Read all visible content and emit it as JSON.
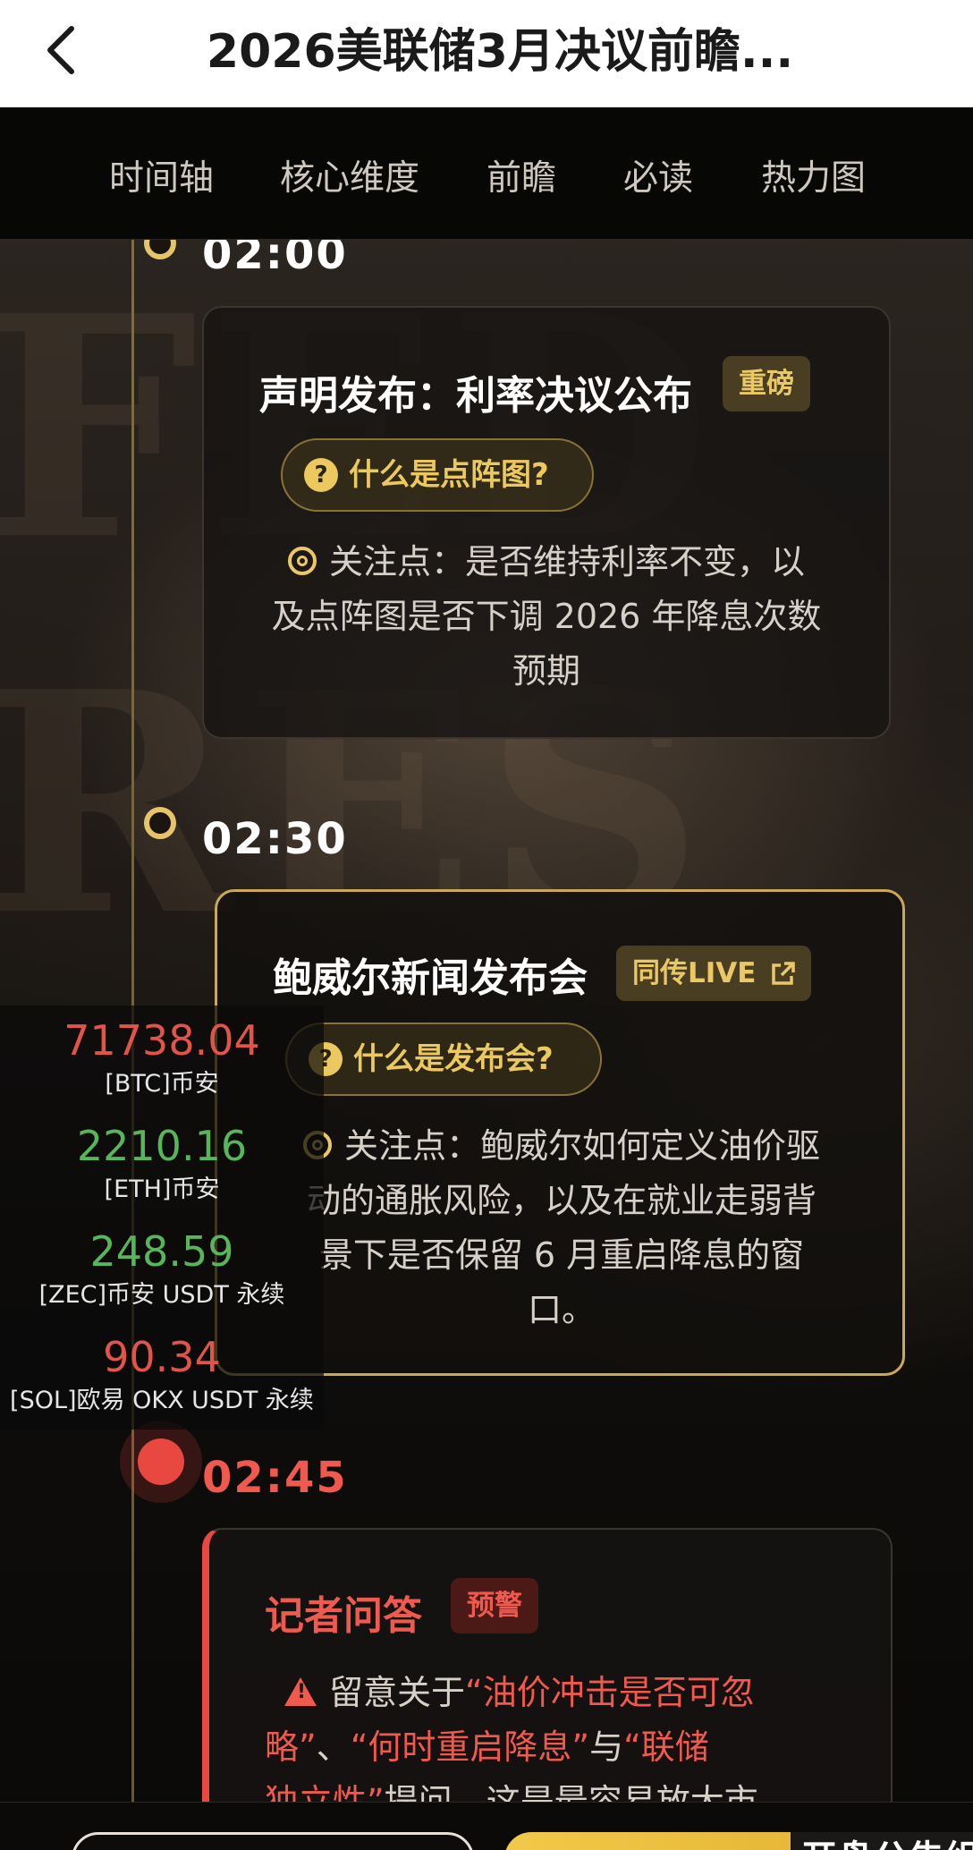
{
  "header": {
    "title": "2026美联储3月决议前瞻..."
  },
  "tabs": [
    "时间轴",
    "核心维度",
    "前瞻",
    "必读",
    "热力图"
  ],
  "events": [
    {
      "time": "02:00",
      "title": "声明发布：利率决议公布",
      "badge": "重磅",
      "pill": "什么是点阵图?",
      "focus_lines": [
        "关注点：是否维持利率不变，以",
        "及点阵图是否下调 2026 年降息次数",
        "预期"
      ]
    },
    {
      "time": "02:30",
      "title": "鲍威尔新闻发布会",
      "badge": "同传LIVE",
      "pill": "什么是发布会?",
      "focus_lines": [
        "关注点：鲍威尔如何定义油价驱",
        "动的通胀风险，以及在就业走弱背",
        "景下是否保留 6 月重启降息的窗",
        "口。"
      ]
    },
    {
      "time": "02:45",
      "title": "记者问答",
      "badge": "预警",
      "warn": {
        "l1a": "留意关于",
        "l1b": "“油价冲击是否可忽",
        "l2a": "略”",
        "l2b": "、",
        "l2c": "“何时重启降息”",
        "l2d": "与",
        "l2e": "“联储",
        "l3a": "独立性”",
        "l3b": "提问，这是最容易放大市"
      }
    }
  ],
  "ticker": [
    {
      "value": "71738.04",
      "label": "[BTC]币安",
      "color": "#e0544a"
    },
    {
      "value": "2210.16",
      "label": "[ETH]币安",
      "color": "#57b65a"
    },
    {
      "value": "248.59",
      "label": "[ZEC]币安 USDT 永续",
      "color": "#57b65a"
    },
    {
      "value": "90.34",
      "label": "[SOL]欧易 OKX USDT 永续",
      "color": "#e0544a"
    }
  ],
  "bottom": {
    "partial_label": "开盘公告组"
  },
  "icons": {
    "back": "chevron-left-icon",
    "external": "external-link-icon",
    "question": "question-circle-icon",
    "focus": "target-icon",
    "warning": "warning-triangle-icon"
  },
  "colors": {
    "accent_gold": "#e9c865",
    "alert_red": "#f05a4e"
  }
}
